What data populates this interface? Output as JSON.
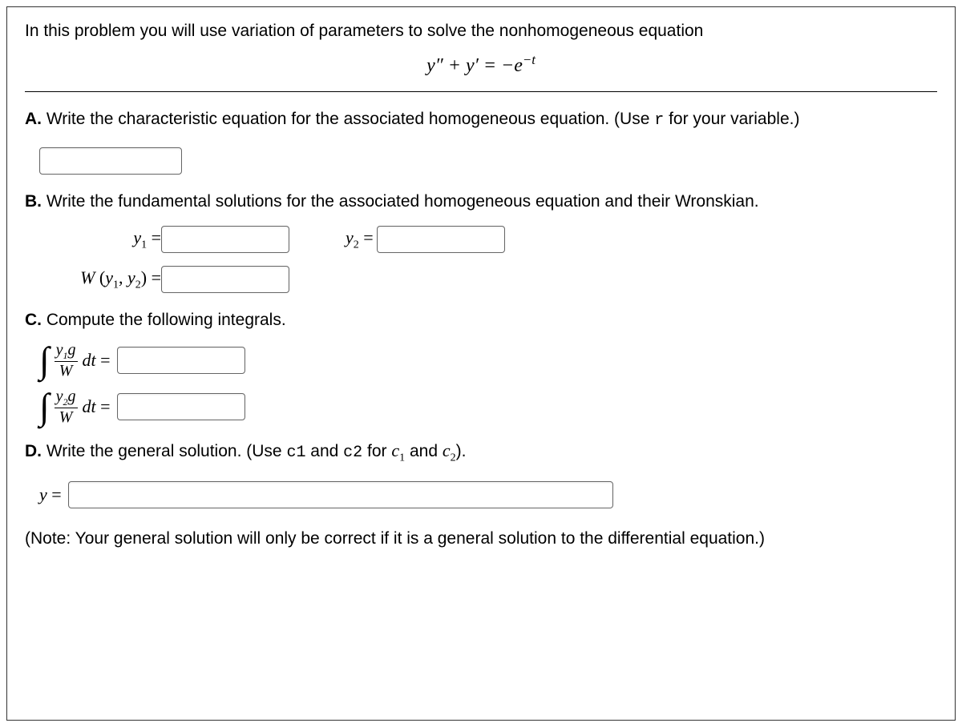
{
  "intro": "In this problem you will use variation of parameters to solve the nonhomogeneous equation",
  "equation_html": "y″ + y′ = −e<sup>−t</sup>",
  "partA": {
    "label": "A.",
    "text": " Write the characteristic equation for the associated homogeneous equation. (Use ",
    "code": "r",
    "text2": " for your variable.)"
  },
  "partB": {
    "label": "B.",
    "text": " Write the fundamental solutions for the associated homogeneous equation and their Wronskian.",
    "y1_label": "y",
    "y1_sub": "1",
    "eq": " = ",
    "y2_label": "y",
    "y2_sub": "2",
    "w_label": "W (y",
    "w_sub1": "1",
    "w_comma": ", y",
    "w_sub2": "2",
    "w_close": ") = "
  },
  "partC": {
    "label": "C.",
    "text": " Compute the following integrals.",
    "int1_num": "y₁g",
    "int1_den": "W",
    "dt_eq": " dt = ",
    "int2_num": "y₂g",
    "int2_den": "W"
  },
  "partD": {
    "label": "D.",
    "text": " Write the general solution. (Use ",
    "code1": "c1",
    "mid": " and ",
    "code2": "c2",
    "text2": " for ",
    "c1_it": "c",
    "c1_sub": "1",
    "and2": " and ",
    "c2_it": "c",
    "c2_sub": "2",
    "close": ").",
    "y_eq": "y = "
  },
  "note": "(Note: Your general solution will only be correct if it is a general solution to the differential equation.)"
}
